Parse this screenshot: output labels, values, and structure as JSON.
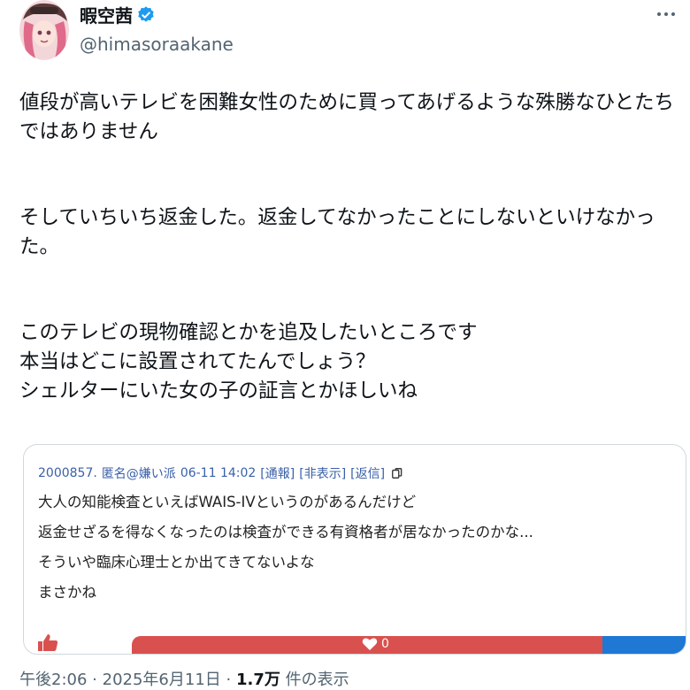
{
  "account": {
    "display_name": "暇空茜",
    "handle": "@himasoraakane",
    "verified_icon": "verified-badge-icon",
    "brand_color": "#1d9bf0"
  },
  "tweet": {
    "paragraphs": [
      [
        "値段が高いテレビを困難女性のために買ってあげるような殊勝なひとたち",
        "ではありません"
      ],
      [
        "そしていちいち返金した。返金してなかったことにしないといけなかっ",
        "た。"
      ],
      [
        "このテレビの現物確認とかを追及したいところです",
        "本当はどこに設置されてたんでしょう？",
        "シェルターにいた女の子の証言とかほしいね"
      ]
    ]
  },
  "quoted_card": {
    "header": {
      "post_id": "2000857.",
      "name": "匿名@嫌い派",
      "datetime": "06-11 14:02",
      "report_link": "[通報]",
      "hide_link": "[非表示]",
      "reply_link": "[返信]",
      "copy_icon": "copy-icon"
    },
    "body_lines": [
      "大人の知能検査といえばWAIS-IVというのがあるんだけど",
      "返金せざるを得なくなったのは検査ができる有資格者が居なかったのかな...",
      "そういや臨床心理士とか出てきてないよな",
      "まさかね"
    ],
    "reactions": {
      "thumb_icon": "thumbs-up-icon",
      "heart_icon": "heart-icon",
      "like_count": "0",
      "red_color": "#d9514f",
      "blue_color": "#1e78d4"
    }
  },
  "meta": {
    "time": "午後2:06",
    "separator": "·",
    "date": "2025年6月11日",
    "views_count": "1.7万",
    "views_label": "件の表示"
  }
}
